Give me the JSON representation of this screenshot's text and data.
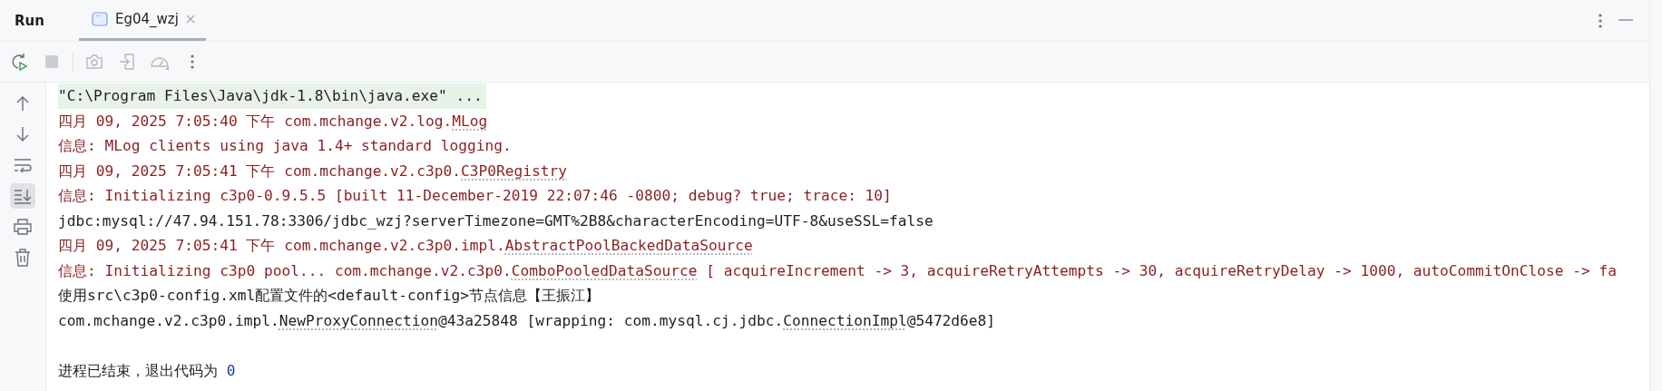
{
  "tool_window": {
    "title": "Run"
  },
  "tabs": [
    {
      "label": "Eg04_wzj",
      "selected": true
    }
  ],
  "toolbar": [
    {
      "kind": "rerun",
      "disabled": false
    },
    {
      "kind": "stop",
      "disabled": true
    },
    {
      "kind": "camera",
      "disabled": true
    },
    {
      "kind": "attach",
      "disabled": true
    },
    {
      "kind": "gauge",
      "disabled": true
    },
    {
      "kind": "more",
      "disabled": false
    }
  ],
  "gutter": [
    {
      "kind": "up",
      "selected": false
    },
    {
      "kind": "down",
      "selected": false
    },
    {
      "kind": "wrap",
      "selected": false
    },
    {
      "kind": "scroll-end",
      "selected": true
    },
    {
      "kind": "print",
      "selected": false
    },
    {
      "kind": "trash",
      "selected": false
    }
  ],
  "console": [
    {
      "kind": "command",
      "segments": [
        {
          "kind": "text",
          "text": "\"C:\\Program Files\\Java\\jdk-1.8\\bin\\java.exe\" ..."
        }
      ]
    },
    {
      "kind": "stderr",
      "segments": [
        {
          "kind": "text",
          "text": "四月 09, 2025 7:05:40 下午 com.mchange.v2.log."
        },
        {
          "kind": "link",
          "text": "MLog"
        }
      ]
    },
    {
      "kind": "stderr",
      "segments": [
        {
          "kind": "text",
          "text": "信息: MLog clients using java 1.4+ standard logging."
        }
      ]
    },
    {
      "kind": "stderr",
      "segments": [
        {
          "kind": "text",
          "text": "四月 09, 2025 7:05:41 下午 com.mchange.v2.c3p0."
        },
        {
          "kind": "link",
          "text": "C3P0Registry"
        }
      ]
    },
    {
      "kind": "stderr",
      "segments": [
        {
          "kind": "text",
          "text": "信息: Initializing c3p0-0.9.5.5 [built 11-December-2019 22:07:46 -0800; debug? true; trace: 10]"
        }
      ]
    },
    {
      "kind": "stdout",
      "segments": [
        {
          "kind": "text",
          "text": "jdbc:mysql://47.94.151.78:3306/jdbc_wzj?serverTimezone=GMT%2B8&characterEncoding=UTF-8&useSSL=false"
        }
      ]
    },
    {
      "kind": "stderr",
      "segments": [
        {
          "kind": "text",
          "text": "四月 09, 2025 7:05:41 下午 com.mchange.v2.c3p0.impl."
        },
        {
          "kind": "link",
          "text": "AbstractPoolBackedDataSource"
        }
      ]
    },
    {
      "kind": "stderr",
      "segments": [
        {
          "kind": "text",
          "text": "信息: Initializing c3p0 pool... com.mchange.v2.c3p0."
        },
        {
          "kind": "link",
          "text": "ComboPooledDataSource"
        },
        {
          "kind": "text",
          "text": " [ acquireIncrement -> 3, acquireRetryAttempts -> 30, acquireRetryDelay -> 1000, autoCommitOnClose -> fa"
        }
      ]
    },
    {
      "kind": "stdout",
      "segments": [
        {
          "kind": "text",
          "text": "使用src\\c3p0-config.xml配置文件的<default-config>节点信息【王振江】"
        }
      ]
    },
    {
      "kind": "stdout",
      "segments": [
        {
          "kind": "text",
          "text": "com.mchange.v2.c3p0.impl."
        },
        {
          "kind": "link",
          "text": "NewProxyConnection"
        },
        {
          "kind": "text",
          "text": "@43a25848 [wrapping: com.mysql.cj.jdbc."
        },
        {
          "kind": "link",
          "text": "ConnectionImpl"
        },
        {
          "kind": "text",
          "text": "@5472d6e8]"
        }
      ]
    },
    {
      "kind": "exit",
      "segments": [
        {
          "kind": "text",
          "text": "进程已结束，退出代码为 "
        },
        {
          "kind": "number",
          "text": "0"
        }
      ]
    }
  ]
}
